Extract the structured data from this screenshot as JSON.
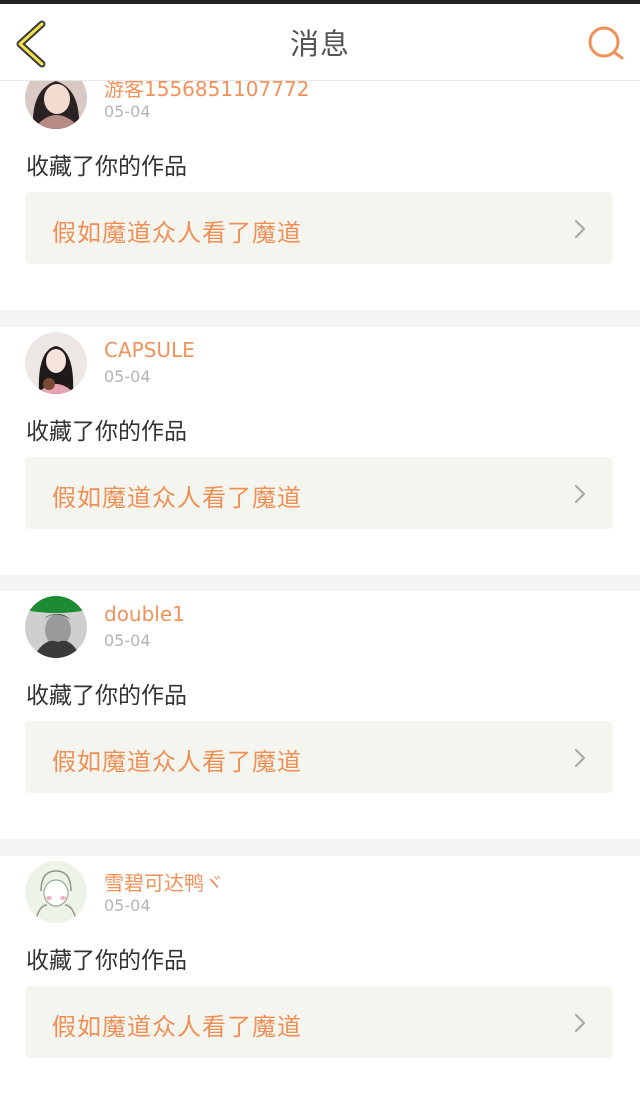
{
  "status_bar": {},
  "header": {
    "title": "消息",
    "back_icon": "chevron-left-icon",
    "search_icon": "search-icon",
    "accent": "#f0925a"
  },
  "notifications": [
    {
      "username": "游客1556851107772",
      "date": "05-04",
      "action": "收藏了你的作品",
      "work_title": "假如魔道众人看了魔道"
    },
    {
      "username": "CAPSULE",
      "date": "05-04",
      "action": "收藏了你的作品",
      "work_title": "假如魔道众人看了魔道"
    },
    {
      "username": "double1",
      "date": "05-04",
      "action": "收藏了你的作品",
      "work_title": "假如魔道众人看了魔道"
    },
    {
      "username": "雪碧可达鸭ヾ",
      "date": "05-04",
      "action": "收藏了你的作品",
      "work_title": "假如魔道众人看了魔道"
    }
  ]
}
